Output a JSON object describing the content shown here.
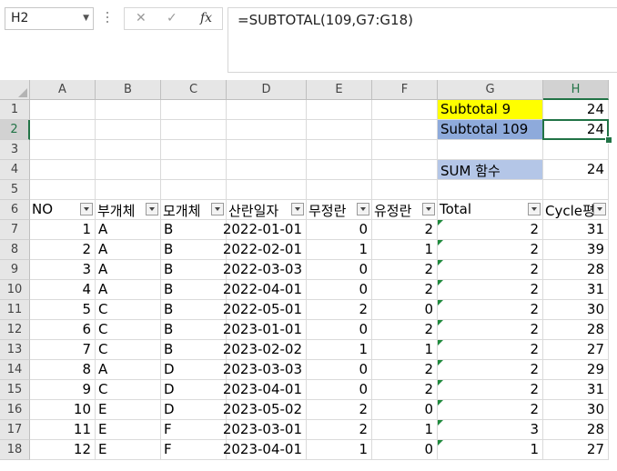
{
  "name_box": "H2",
  "formula": "=SUBTOTAL(109,G7:G18)",
  "formula_buttons": {
    "cancel": "✕",
    "enter": "✓",
    "fx": "fx"
  },
  "columns": [
    "A",
    "B",
    "C",
    "D",
    "E",
    "F",
    "G",
    "H"
  ],
  "rows": [
    "1",
    "2",
    "3",
    "4",
    "5",
    "6",
    "7",
    "8",
    "9",
    "10",
    "11",
    "12",
    "13",
    "14",
    "15",
    "16",
    "17",
    "18"
  ],
  "summary": {
    "g1": "Subtotal 9",
    "h1": "24",
    "g2": "Subtotal 109",
    "h2": "24",
    "g4": "SUM 함수",
    "h4": "24"
  },
  "table_headers": [
    "NO",
    "부개체",
    "모개체",
    "산란일자",
    "무정란",
    "유정란",
    "Total",
    "Cycle평"
  ],
  "table_rows": [
    [
      "1",
      "A",
      "B",
      "2022-01-01",
      "0",
      "2",
      "2",
      "31"
    ],
    [
      "2",
      "A",
      "B",
      "2022-02-01",
      "1",
      "1",
      "2",
      "39"
    ],
    [
      "3",
      "A",
      "B",
      "2022-03-03",
      "0",
      "2",
      "2",
      "28"
    ],
    [
      "4",
      "A",
      "B",
      "2022-04-01",
      "0",
      "2",
      "2",
      "31"
    ],
    [
      "5",
      "C",
      "B",
      "2022-05-01",
      "2",
      "0",
      "2",
      "30"
    ],
    [
      "6",
      "C",
      "B",
      "2023-01-01",
      "0",
      "2",
      "2",
      "28"
    ],
    [
      "7",
      "C",
      "B",
      "2023-02-02",
      "1",
      "1",
      "2",
      "27"
    ],
    [
      "8",
      "A",
      "D",
      "2023-03-03",
      "0",
      "2",
      "2",
      "29"
    ],
    [
      "9",
      "C",
      "D",
      "2023-04-01",
      "0",
      "2",
      "2",
      "31"
    ],
    [
      "10",
      "E",
      "D",
      "2023-05-02",
      "2",
      "0",
      "2",
      "30"
    ],
    [
      "11",
      "E",
      "F",
      "2023-03-01",
      "2",
      "1",
      "3",
      "28"
    ],
    [
      "12",
      "E",
      "F",
      "2023-04-01",
      "1",
      "0",
      "1",
      "27"
    ]
  ],
  "colors": {
    "yellow": "#ffff00",
    "blue_dark": "#8eaadb",
    "blue_light": "#b4c6e7",
    "selection": "#217346"
  }
}
